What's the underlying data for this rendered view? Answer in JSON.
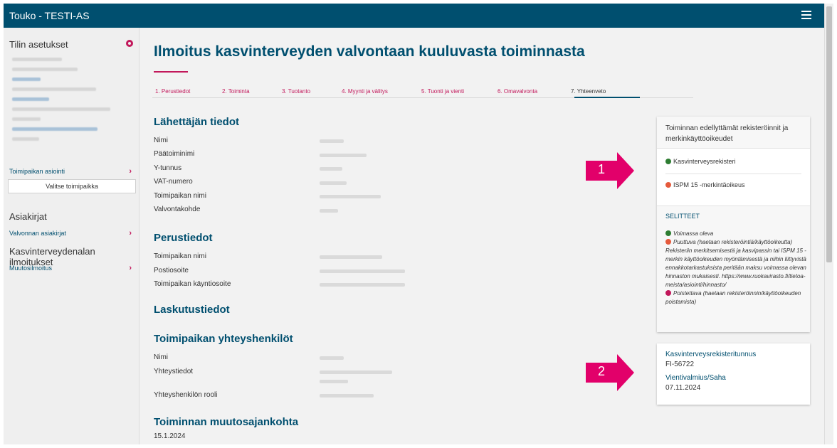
{
  "app": {
    "title": "Touko - TESTI-AS",
    "menu_icon": "hamburger-icon"
  },
  "sidebar": {
    "account_settings": "Tilin asetukset",
    "site_matters": "Toimipaikan asiointi",
    "choose_site_button": "Valitse toimipaikka",
    "documents": "Asiakirjat",
    "control_documents": "Valvonnan asiakirjat",
    "plant_health_notices": "Kasvinterveydenalan ilmoitukset",
    "change_notice": "Muutosilmoitus",
    "accent_color": "#c2185b"
  },
  "main": {
    "title": "Ilmoitus kasvinterveyden valvontaan kuuluvasta toiminnasta",
    "tabs": [
      {
        "label": "1. Perustiedot"
      },
      {
        "label": "2. Toiminta"
      },
      {
        "label": "3. Tuotanto"
      },
      {
        "label": "4. Myynti ja välitys"
      },
      {
        "label": "5. Tuonti ja vienti"
      },
      {
        "label": "6. Omavalvonta"
      },
      {
        "label": "7. Yhteenveto"
      }
    ],
    "sender": {
      "heading": "Lähettäjän tiedot",
      "labels": [
        "Nimi",
        "Päätoiminimi",
        "Y-tunnus",
        "VAT-numero",
        "Toimipaikan nimi",
        "Valvontakohde"
      ]
    },
    "basic": {
      "heading": "Perustiedot",
      "labels": [
        "Toimipaikan nimi",
        "Postiosoite",
        "Toimipaikan käyntiosoite"
      ]
    },
    "billing": {
      "heading": "Laskutustiedot"
    },
    "contacts": {
      "heading": "Toimipaikan yhteyshenkilöt",
      "labels": [
        "Nimi",
        "Yhteystiedot",
        "Yhteyshenkilön rooli"
      ]
    },
    "change_time": {
      "heading": "Toiminnan muutosajankohta",
      "value": "15.1.2024"
    }
  },
  "registrations_card": {
    "heading": "Toiminnan edellyttämät rekisteröinnit ja merkinkäyttöoikeudet",
    "items": [
      {
        "label": "Kasvinterveysrekisteri",
        "status": "valid"
      },
      {
        "label": "ISPM 15 -merkintäoikeus",
        "status": "missing"
      }
    ],
    "legend_title": "SELITTEET",
    "legend_valid": "Voimassa oleva",
    "legend_missing": "Puuttuva (haetaan rekisteröintiä/käyttöoikeutta) Rekisteriin merkitsemisestä ja kasvipassin tai ISPM 15 -merkin käyttöoikeuden myöntämisestä ja niihin liittyvistä ennakkotarkastuksista peritään maksu voimassa olevan hinnaston mukaisesti. https://www.ruokavirasto.fi/tietoa-meista/asiointi/hinnasto/",
    "legend_removed": "Poistettava (haetaan rekisteröinnin/käyttöoikeuden poistamista)",
    "colors": {
      "valid": "#2e7d32",
      "missing": "#e55a3c",
      "removed": "#c2185b"
    }
  },
  "registry_card": {
    "registry_label": "Kasvinterveysrekisteritunnus",
    "registry_value": "FI-56722",
    "export_label": "Vientivalmius/Saha",
    "export_value": "07.11.2024"
  },
  "callouts": [
    {
      "number": "1"
    },
    {
      "number": "2"
    }
  ],
  "colors": {
    "topbar": "#004f6f",
    "accent": "#c2185b",
    "callout": "#e2006a"
  }
}
